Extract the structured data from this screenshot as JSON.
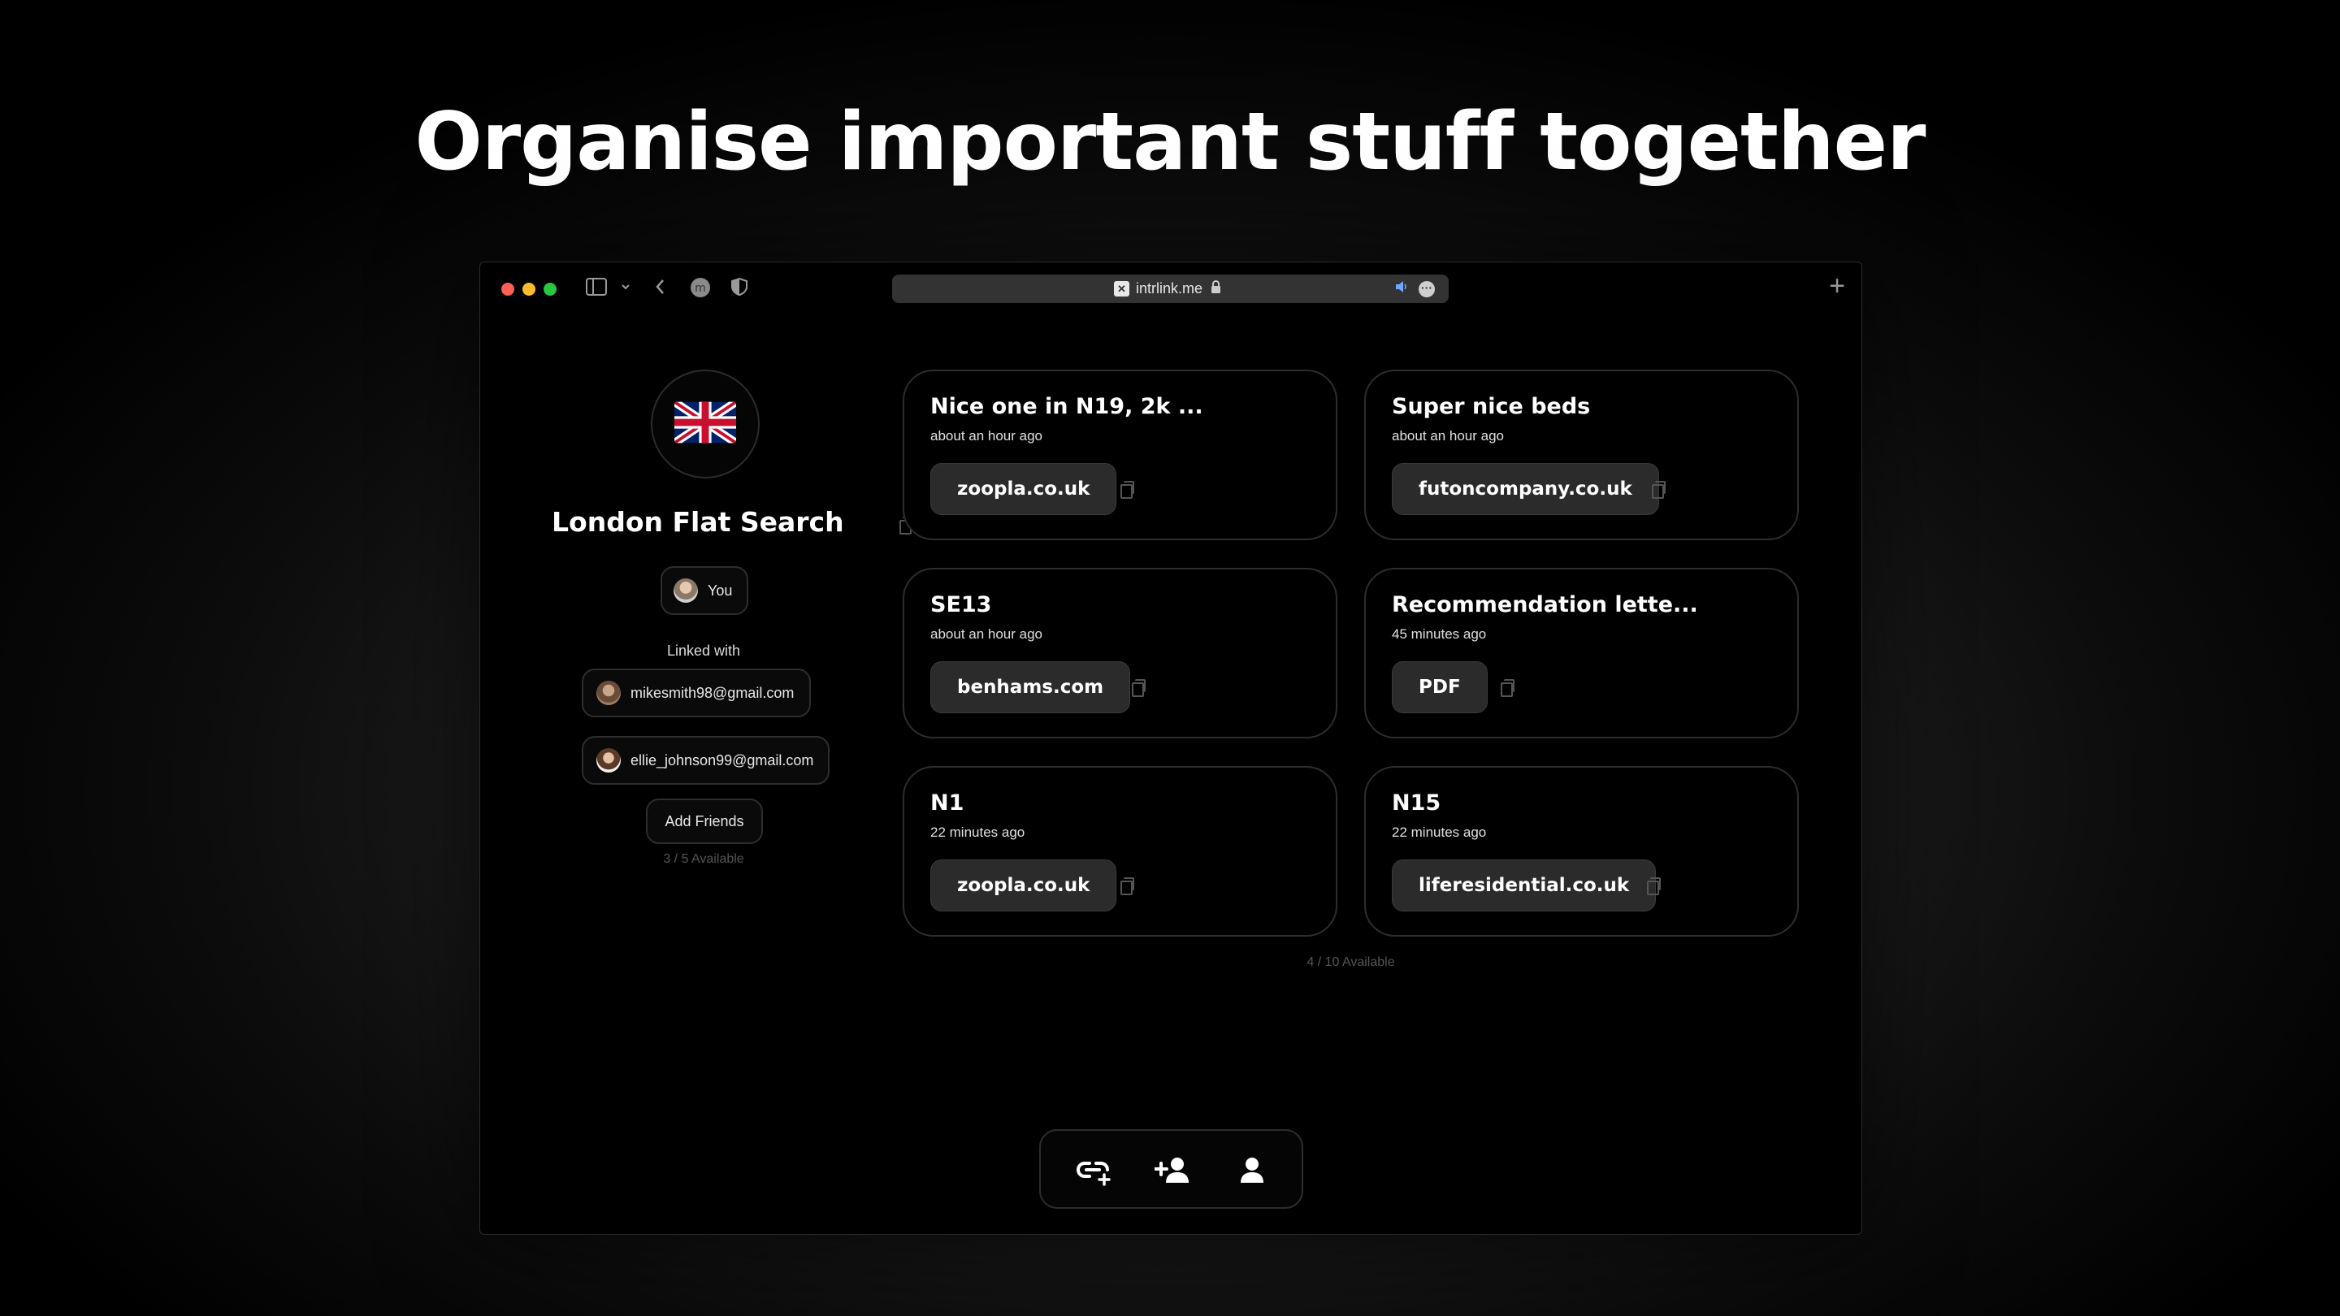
{
  "headline": "Organise important stuff together",
  "browser": {
    "url": "intrlink.me",
    "new_tab": "+"
  },
  "room": {
    "emoji": "🇬🇧",
    "title": "London Flat Search",
    "owner_label": "You",
    "linked_with_label": "Linked with",
    "linked_users": [
      {
        "email": "mikesmith98@gmail.com"
      },
      {
        "email": "ellie_johnson99@gmail.com"
      }
    ],
    "add_friends_label": "Add Friends",
    "friends_available": "3 / 5 Available"
  },
  "links": [
    {
      "title": "Nice one in N19, 2k ...",
      "time": "about an hour ago",
      "chip": "zoopla.co.uk"
    },
    {
      "title": "Super nice beds",
      "time": "about an hour ago",
      "chip": "futoncompany.co.uk"
    },
    {
      "title": "SE13",
      "time": "about an hour ago",
      "chip": "benhams.com"
    },
    {
      "title": "Recommendation lette...",
      "time": "45 minutes ago",
      "chip": "PDF"
    },
    {
      "title": "N1",
      "time": "22 minutes ago",
      "chip": "zoopla.co.uk"
    },
    {
      "title": "N15",
      "time": "22 minutes ago",
      "chip": "liferesidential.co.uk"
    }
  ],
  "links_available": "4 / 10 Available",
  "toolbar": {
    "items": [
      {
        "icon": "add-link-icon"
      },
      {
        "icon": "add-person-icon"
      },
      {
        "icon": "person-icon"
      }
    ]
  },
  "colors": {
    "background": "#000000",
    "card_border": "#2d2d2d",
    "chip_background": "#2b2b2b"
  }
}
